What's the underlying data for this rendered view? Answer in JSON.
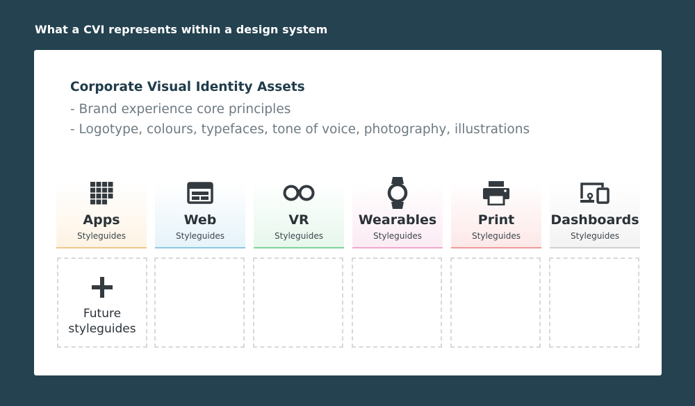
{
  "header": {
    "title": "What a CVI represents within a design system"
  },
  "cvi": {
    "heading": "Corporate Visual Identity Assets",
    "lines": [
      "- Brand experience core principles",
      "- Logotype, colours, typefaces, tone of voice, photography, illustrations"
    ]
  },
  "tiles": [
    {
      "label": "Apps",
      "sub": "Styleguides",
      "icon": "grid-icon",
      "accent": "#f0c78a",
      "tint": "#fdf3e4"
    },
    {
      "label": "Web",
      "sub": "Styleguides",
      "icon": "browser-window-icon",
      "accent": "#8ec6e0",
      "tint": "#e6f3fa"
    },
    {
      "label": "VR",
      "sub": "Styleguides",
      "icon": "vr-headset-icon",
      "accent": "#7fd39c",
      "tint": "#e6f7ec"
    },
    {
      "label": "Wearables",
      "sub": "Styleguides",
      "icon": "smartwatch-icon",
      "accent": "#f0a8cc",
      "tint": "#fcebf4"
    },
    {
      "label": "Print",
      "sub": "Styleguides",
      "icon": "printer-icon",
      "accent": "#f0999b",
      "tint": "#fde8e8"
    },
    {
      "label": "Dashboards",
      "sub": "Styleguides",
      "icon": "devices-icon",
      "accent": "#d0d0d0",
      "tint": "#f3f3f3"
    }
  ],
  "future": {
    "line1": "Future",
    "line2": "styleguides",
    "icon": "plus-icon"
  }
}
